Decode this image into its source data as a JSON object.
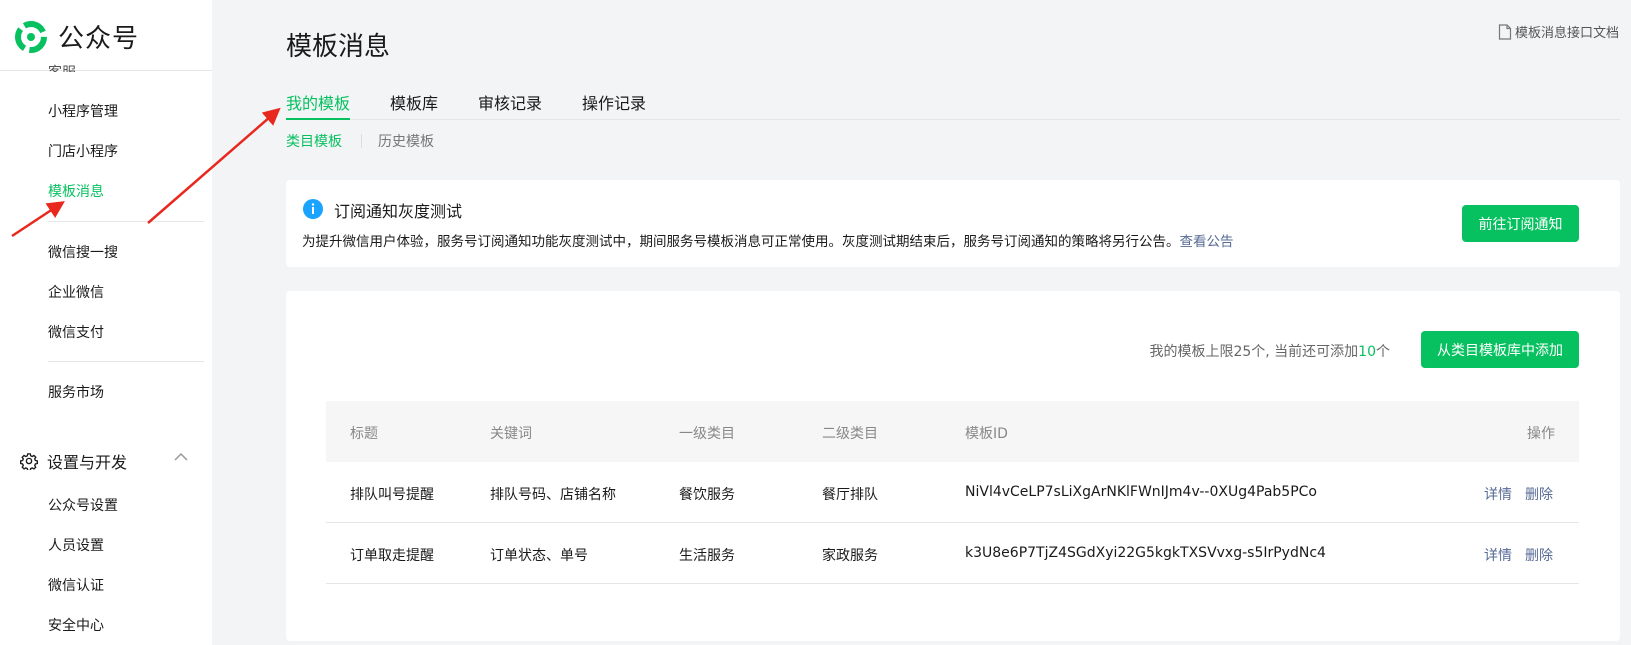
{
  "brand": {
    "name": "公众号",
    "color": "#07c160"
  },
  "sidebar": {
    "partial_item": "客服",
    "group1": [
      "小程序管理",
      "门店小程序",
      "模板消息"
    ],
    "active_item": "模板消息",
    "group2": [
      "微信搜一搜",
      "企业微信",
      "微信支付"
    ],
    "group3": [
      "服务市场"
    ],
    "section": {
      "title": "设置与开发",
      "icon": "gear-icon",
      "chevron": "chevron-up-icon"
    },
    "section_items": [
      "公众号设置",
      "人员设置",
      "微信认证",
      "安全中心"
    ]
  },
  "header": {
    "title": "模板消息",
    "doc_link": "模板消息接口文档",
    "doc_icon": "document-icon"
  },
  "tabs": [
    "我的模板",
    "模板库",
    "审核记录",
    "操作记录"
  ],
  "active_tab": "我的模板",
  "subtabs": [
    "类目模板",
    "历史模板"
  ],
  "active_subtab": "类目模板",
  "notice": {
    "icon": "info-icon",
    "title": "订阅通知灰度测试",
    "body": "为提升微信用户体验，服务号订阅通知功能灰度测试中，期间服务号模板消息可正常使用。灰度测试期结束后，服务号订阅通知的策略将另行公告。",
    "link": "查看公告",
    "button": "前往订阅通知"
  },
  "templates": {
    "quota_prefix": "我的模板上限25个, 当前还可添加",
    "quota_remaining": "10",
    "quota_suffix": "个",
    "add_button": "从类目模板库中添加",
    "columns": [
      "标题",
      "关键词",
      "一级类目",
      "二级类目",
      "模板ID",
      "操作"
    ],
    "rows": [
      {
        "title": "排队叫号提醒",
        "keywords": "排队号码、店铺名称",
        "category1": "餐饮服务",
        "category2": "餐厅排队",
        "template_id": "NiVl4vCeLP7sLiXgArNKlFWnIJm4v--0XUg4Pab5PCo",
        "detail": "详情",
        "delete": "删除"
      },
      {
        "title": "订单取走提醒",
        "keywords": "订单状态、单号",
        "category1": "生活服务",
        "category2": "家政服务",
        "template_id": "k3U8e6P7TjZ4SGdXyi22G5kgkTXSVvxg-s5IrPydNc4",
        "detail": "详情",
        "delete": "删除"
      }
    ]
  },
  "colors": {
    "accent": "#07c160",
    "link": "#576b95",
    "annotation": "#e8281e",
    "info": "#1aa3ff"
  }
}
